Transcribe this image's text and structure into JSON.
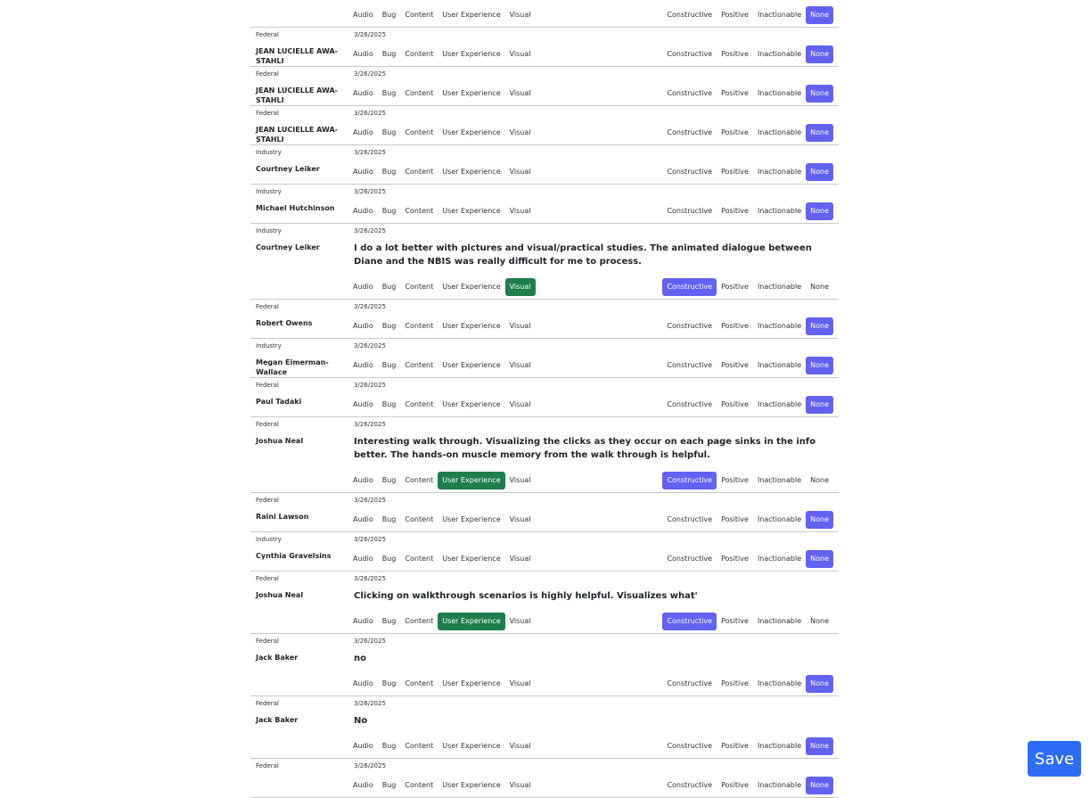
{
  "categories": [
    "Audio",
    "Bug",
    "Content",
    "User Experience",
    "Visual"
  ],
  "sentiments": [
    "Constructive",
    "Positive",
    "Inactionable",
    "None"
  ],
  "colors": {
    "category_selected": "#1e7e4c",
    "sentiment_selected": "#6261f2",
    "save": "#2f6cf5"
  },
  "save_label": "Save",
  "rows": [
    {
      "group": "",
      "date": "",
      "name": "",
      "comment": "",
      "category": null,
      "sentiment": "None"
    },
    {
      "group": "Federal",
      "date": "3/26/2025",
      "name": "JEAN LUCIELLE AWA-STAHLI",
      "comment": "",
      "category": null,
      "sentiment": "None"
    },
    {
      "group": "Federal",
      "date": "3/26/2025",
      "name": "JEAN LUCIELLE AWA-STAHLI",
      "comment": "",
      "category": null,
      "sentiment": "None"
    },
    {
      "group": "Federal",
      "date": "3/26/2025",
      "name": "JEAN LUCIELLE AWA-STAHLI",
      "comment": "",
      "category": null,
      "sentiment": "None"
    },
    {
      "group": "Industry",
      "date": "3/26/2025",
      "name": "Courtney Leiker",
      "comment": "",
      "category": null,
      "sentiment": "None"
    },
    {
      "group": "Industry",
      "date": "3/26/2025",
      "name": "Michael Hutchinson",
      "comment": "",
      "category": null,
      "sentiment": "None"
    },
    {
      "group": "Industry",
      "date": "3/26/2025",
      "name": "Courtney Leiker",
      "comment": "I do a lot better with pictures and visual/practical studies. The animated dialogue between Diane and the NBIS was really difficult for me to process.",
      "category": "Visual",
      "sentiment": "Constructive"
    },
    {
      "group": "Federal",
      "date": "3/26/2025",
      "name": "Robert Owens",
      "comment": "",
      "category": null,
      "sentiment": "None"
    },
    {
      "group": "Industry",
      "date": "3/26/2025",
      "name": "Megan Eimerman-Wallace",
      "comment": "",
      "category": null,
      "sentiment": "None"
    },
    {
      "group": "Federal",
      "date": "3/26/2025",
      "name": "Paul Tadaki",
      "comment": "",
      "category": null,
      "sentiment": "None"
    },
    {
      "group": "Federal",
      "date": "3/26/2025",
      "name": "Joshua Neal",
      "comment": "Interesting walk through. Visualizing the clicks as they occur on each page sinks in the info better. The hands-on muscle memory from the walk through is helpful.",
      "category": "User Experience",
      "sentiment": "Constructive"
    },
    {
      "group": "Federal",
      "date": "3/26/2025",
      "name": "Raini Lawson",
      "comment": "",
      "category": null,
      "sentiment": "None"
    },
    {
      "group": "Industry",
      "date": "3/26/2025",
      "name": "Cynthia Gravelsins",
      "comment": "",
      "category": null,
      "sentiment": "None"
    },
    {
      "group": "Federal",
      "date": "3/26/2025",
      "name": "Joshua Neal",
      "comment": "Clicking on walkthrough scenarios is highly helpful. Visualizes what'",
      "category": "User Experience",
      "sentiment": "Constructive"
    },
    {
      "group": "Federal",
      "date": "3/26/2025",
      "name": "Jack Baker",
      "comment": "no",
      "category": null,
      "sentiment": "None"
    },
    {
      "group": "Federal",
      "date": "3/26/2025",
      "name": "Jack Baker",
      "comment": "No",
      "category": null,
      "sentiment": "None"
    },
    {
      "group": "Federal",
      "date": "3/26/2025",
      "name": "",
      "comment": "",
      "category": null,
      "sentiment": "None"
    }
  ]
}
